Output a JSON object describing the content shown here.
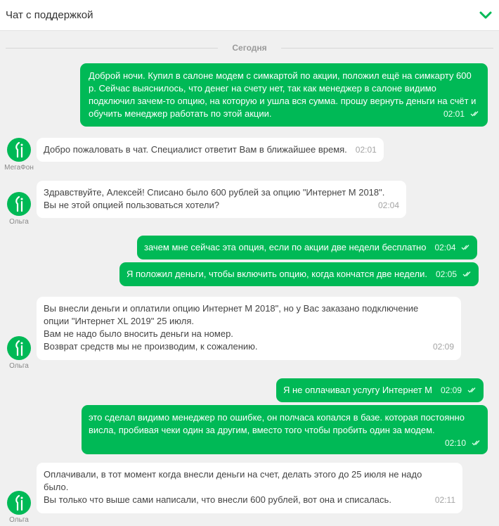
{
  "header": {
    "title": "Чат с поддержкой"
  },
  "date_separator": "Сегодня",
  "messages": [
    {
      "text": "Доброй ночи. Купил в салоне модем с симкартой по акции, положил ещё на симкарту 600 р. Сейчас выяснилось, что денег на счету нет, так как менеджер в салоне видимо подключил зачем-то опцию, на которую и ушла вся сумма. прошу вернуть деньги на счёт и обучить менеджер работать по этой акции.",
      "time": "02:01"
    },
    {
      "text": "Добро пожаловать в чат. Специалист ответит Вам в ближайшее время.",
      "time": "02:01",
      "sender": "МегаФон"
    },
    {
      "lines": [
        "Здравствуйте, Алексей! Списано было 600 рублей за опцию \"Интернет М 2018\".",
        "Вы не этой опцией пользоваться хотели?"
      ],
      "time": "02:04",
      "sender": "Ольга"
    },
    {
      "text": "зачем мне сейчас эта опция, если по акции две недели бесплатно",
      "time": "02:04"
    },
    {
      "text": "Я положил деньги, чтобы включить опцию, когда кончатся две недели.",
      "time": "02:05"
    },
    {
      "lines": [
        "Вы внесли деньги и оплатили опцию Интернет М 2018\", но у Вас заказано подключение",
        "опции \"Интернет XL 2019\" 25 июля.",
        "Вам не надо было вносить деньги на номер.",
        "Возврат средств мы не производим, к сожалению."
      ],
      "time": "02:09",
      "sender": "Ольга"
    },
    {
      "text": "Я не оплачивал услугу Интернет М",
      "time": "02:09"
    },
    {
      "text": "это сделал видимо менеджер по ошибке, он полчаса копался в базе. которая постоянно висла, пробивая чеки один за другим, вместо того чтобы пробить один за модем.",
      "time": "02:10"
    },
    {
      "lines": [
        "Оплачивали, в тот момент когда внесли деньги на счет, делать этого до 25 июля не надо",
        "было.",
        "Вы только что выше сами написали, что внесли 600 рублей, вот она и списалась."
      ],
      "time": "02:11",
      "sender": "Ольга"
    }
  ],
  "colors": {
    "accent": "#00b956",
    "background": "#f0f0f0",
    "incoming_bubble": "#ffffff"
  },
  "icons": {
    "header_toggle": "chevron-down-icon",
    "delivered": "double-check-icon",
    "avatar": "megafon-logo-icon"
  }
}
